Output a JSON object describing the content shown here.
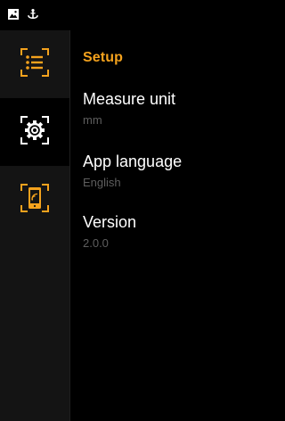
{
  "status_bar": {
    "icons": [
      "image-icon",
      "usb-anchor-icon"
    ]
  },
  "sidebar": {
    "items": [
      {
        "icon": "list-icon",
        "active": false
      },
      {
        "icon": "gear-icon",
        "active": true
      },
      {
        "icon": "tablet-wireless-icon",
        "active": false
      }
    ]
  },
  "header": {
    "title": "Setup"
  },
  "settings": [
    {
      "label": "Measure unit",
      "value": "mm"
    },
    {
      "label": "App language",
      "value": "English"
    },
    {
      "label": "Version",
      "value": "2.0.0"
    }
  ],
  "colors": {
    "accent": "#f4a21d",
    "background": "#000000",
    "sidebar": "#141414",
    "muted_text": "#5e5e5e"
  }
}
